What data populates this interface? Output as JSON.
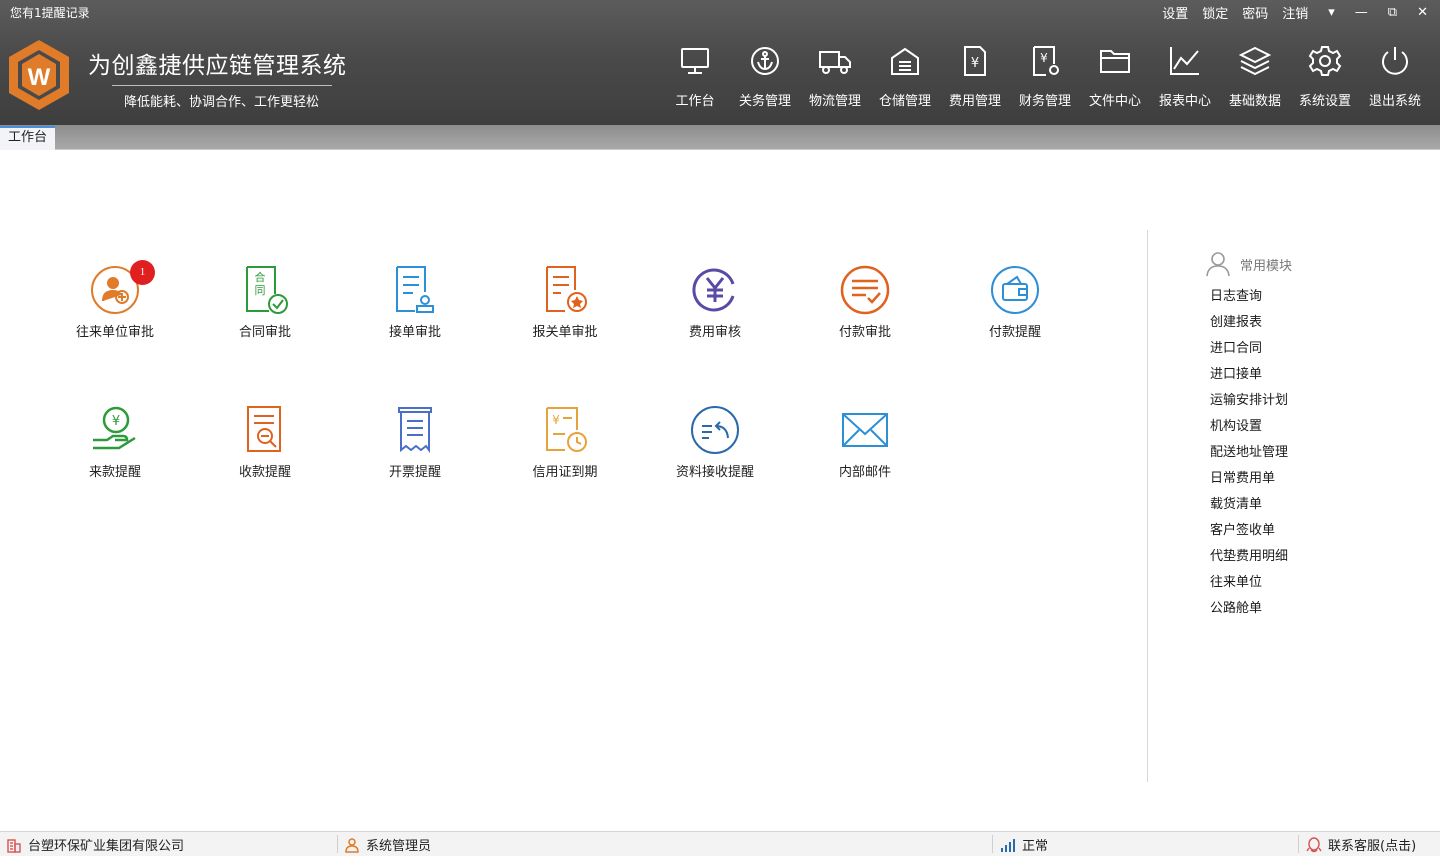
{
  "header": {
    "reminder": "您有1提醒记录",
    "links": [
      "设置",
      "锁定",
      "密码",
      "注销"
    ],
    "window_controls": [
      "▾",
      "—",
      "⧉",
      "✕"
    ],
    "title": "为创鑫捷供应链管理系统",
    "subtitle": "降低能耗、协调合作、工作更轻松",
    "logo_letter": "W"
  },
  "nav": [
    {
      "label": "工作台",
      "icon": "monitor-icon"
    },
    {
      "label": "关务管理",
      "icon": "anchor-icon"
    },
    {
      "label": "物流管理",
      "icon": "truck-icon"
    },
    {
      "label": "仓储管理",
      "icon": "warehouse-icon"
    },
    {
      "label": "费用管理",
      "icon": "yen-document-icon"
    },
    {
      "label": "财务管理",
      "icon": "finance-gear-icon"
    },
    {
      "label": "文件中心",
      "icon": "folder-icon"
    },
    {
      "label": "报表中心",
      "icon": "line-chart-icon"
    },
    {
      "label": "基础数据",
      "icon": "layers-icon"
    },
    {
      "label": "系统设置",
      "icon": "gear-icon"
    },
    {
      "label": "退出系统",
      "icon": "power-icon"
    }
  ],
  "tabs": [
    {
      "label": "工作台"
    }
  ],
  "tiles": [
    {
      "label": "往来单位审批",
      "icon": "partner-approval-icon",
      "badge": "1"
    },
    {
      "label": "合同审批",
      "icon": "contract-approval-icon"
    },
    {
      "label": "接单审批",
      "icon": "order-approval-icon"
    },
    {
      "label": "报关单审批",
      "icon": "customs-declaration-icon"
    },
    {
      "label": "费用审核",
      "icon": "yen-circle-icon"
    },
    {
      "label": "付款审批",
      "icon": "payment-approval-icon"
    },
    {
      "label": "付款提醒",
      "icon": "wallet-icon"
    },
    {
      "label": "来款提醒",
      "icon": "hand-coin-icon"
    },
    {
      "label": "收款提醒",
      "icon": "receipt-search-icon"
    },
    {
      "label": "开票提醒",
      "icon": "invoice-icon"
    },
    {
      "label": "信用证到期",
      "icon": "credit-clock-icon"
    },
    {
      "label": "资料接收提醒",
      "icon": "data-receive-icon"
    },
    {
      "label": "内部邮件",
      "icon": "mail-icon"
    }
  ],
  "quick": {
    "title": "常用模块",
    "items": [
      "日志查询",
      "创建报表",
      "进口合同",
      "进口接单",
      "运输安排计划",
      "机构设置",
      "配送地址管理",
      "日常费用单",
      "载货清单",
      "客户签收单",
      "代垫费用明细",
      "往来单位",
      "公路舱单"
    ]
  },
  "status": {
    "company": "台塑环保矿业集团有限公司",
    "user": "系统管理员",
    "state": "正常",
    "support": "联系客服(点击)"
  },
  "colors": {
    "header_bg": "#4a4a4a",
    "logo_orange": "#e07b2a",
    "badge_red": "#e02020"
  }
}
